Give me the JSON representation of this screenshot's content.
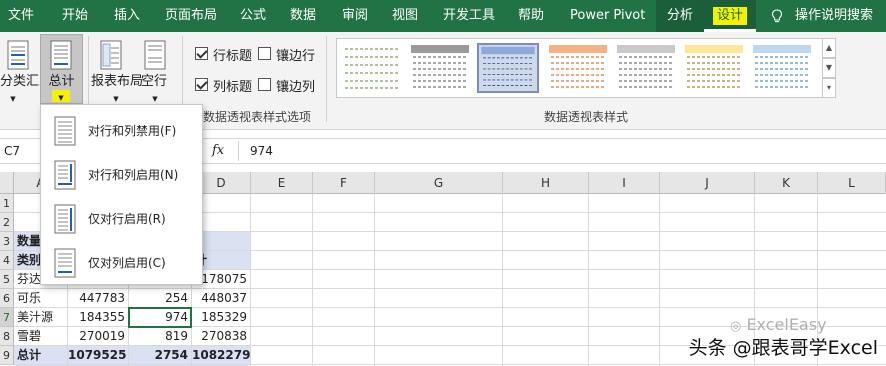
{
  "tabs": {
    "file": "文件",
    "home": "开始",
    "insert": "插入",
    "page_layout": "页面布局",
    "formulas": "公式",
    "data": "数据",
    "review": "审阅",
    "view": "视图",
    "developer": "开发工具",
    "help": "帮助",
    "power_pivot": "Power Pivot",
    "analyze": "分析",
    "design": "设计",
    "tell_me": "操作说明搜索"
  },
  "ribbon": {
    "subtotals": "分类汇总",
    "grand_totals": "总计",
    "report_layout": "报表布局",
    "blank_rows": "空行",
    "row_headers": "行标题",
    "banded_rows": "镶边行",
    "column_headers": "列标题",
    "banded_columns": "镶边列",
    "style_options_group": "数据透视表样式选项",
    "styles_group": "数据透视表样式",
    "row_headers_checked": true,
    "column_headers_checked": true,
    "banded_rows_checked": false,
    "banded_columns_checked": false
  },
  "formula_bar": {
    "name_box": "C7",
    "fx": "fx",
    "value": "974"
  },
  "grand_totals_menu": [
    "对行和列禁用(F)",
    "对行和列启用(N)",
    "仅对行启用(R)",
    "仅对列启用(C)"
  ],
  "columns": [
    "A",
    "B",
    "C",
    "D",
    "E",
    "F",
    "G",
    "H",
    "I",
    "J",
    "K",
    "L"
  ],
  "rows": [
    "1",
    "2",
    "3",
    "4",
    "5",
    "6",
    "7",
    "8",
    "9"
  ],
  "cells": {
    "a3": "数量",
    "a4": "类别",
    "d4": "计",
    "a5": "芬达",
    "d5": "178075",
    "a6": "可乐",
    "b6": "447783",
    "c6": "254",
    "d6": "448037",
    "a7": "美汁源",
    "b7": "184355",
    "c7": "974",
    "d7": "185329",
    "a8": "雪碧",
    "b8": "270019",
    "c8": "819",
    "d8": "270838",
    "a9": "总计",
    "b9": "1079525",
    "c9": "2754",
    "d9": "1082279"
  },
  "watermark": {
    "logo_text": "ExcelEasy",
    "text": "头条 @跟表哥学Excel"
  },
  "colors": {
    "excel_green": "#217346",
    "design_highlight": "#f5f200",
    "pivot_header_fill": "#d9e1f2"
  }
}
